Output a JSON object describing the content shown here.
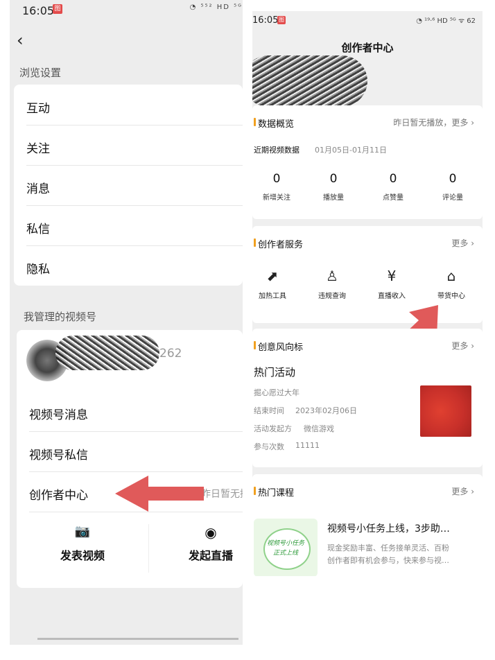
{
  "left": {
    "status": {
      "time": "16:05",
      "badge": "图",
      "icons": "◔ ⁵⁵² HD ⁵ᴳ"
    },
    "back_glyph": "‹",
    "browse_settings_title": "浏览设置",
    "settings_items": [
      "互动",
      "关注",
      "消息",
      "私信",
      "隐私"
    ],
    "managed_title": "我管理的视频号",
    "account_id_suffix": "262",
    "channel_items": [
      "视频号消息",
      "视频号私信",
      "创作者中心"
    ],
    "creator_center_hint": "昨日暂无播",
    "actions": [
      {
        "label": "发表视频",
        "icon": "camera-icon",
        "glyph": "📷"
      },
      {
        "label": "发起直播",
        "icon": "live-icon",
        "glyph": "◉"
      }
    ]
  },
  "right": {
    "status": {
      "time": "16:05",
      "badge": "图",
      "icons": "◔ ¹⁹·⁶ HD ⁵ᴳ ᯤ 62"
    },
    "header_title": "创作者中心",
    "data_overview": {
      "title": "数据概览",
      "more": "昨日暂无播放，更多 ›",
      "recent_label": "近期视频数据",
      "date_range": "01月05日-01月11日",
      "stats": [
        {
          "value": "0",
          "label": "新增关注"
        },
        {
          "value": "0",
          "label": "播放量"
        },
        {
          "value": "0",
          "label": "点赞量"
        },
        {
          "value": "0",
          "label": "评论量"
        }
      ]
    },
    "creator_services": {
      "title": "创作者服务",
      "more": "更多 ›",
      "items": [
        {
          "label": "加热工具",
          "icon": "trend-icon",
          "glyph": "⬈"
        },
        {
          "label": "违规查询",
          "icon": "user-search-icon",
          "glyph": "♙"
        },
        {
          "label": "直播收入",
          "icon": "yuan-icon",
          "glyph": "¥"
        },
        {
          "label": "带货中心",
          "icon": "store-icon",
          "glyph": "⌂"
        }
      ]
    },
    "trends": {
      "title": "创意风向标",
      "more": "更多 ›",
      "activity_title": "热门活动",
      "activity_name": "掘心愿过大年",
      "end_time_label": "结束时间",
      "end_time_value": "2023年02月06日",
      "organizer_label": "活动发起方",
      "organizer_value": "微信游戏",
      "participants_label": "参与次数",
      "participants_value": "11111"
    },
    "courses": {
      "title": "热门课程",
      "more": "更多 ›",
      "course_title": "视频号小任务上线，3步助…",
      "course_desc_line1": "现金奖励丰富、任务接单灵活、百粉",
      "course_desc_line2": "创作者即有机会参与，快来参与视…",
      "thumb_text_line1": "视频号小任务",
      "thumb_text_line2": "正式上线"
    }
  },
  "colors": {
    "accent_orange": "#f0a020",
    "arrow_red": "#e05a5a",
    "thumb_red": "#c8302a"
  }
}
